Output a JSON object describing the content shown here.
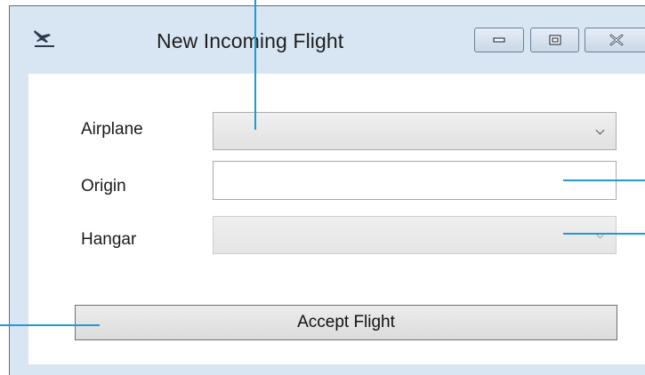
{
  "window": {
    "title": "New Incoming Flight",
    "icon": "airplane-icon",
    "controls": {
      "minimize": "minimize-icon",
      "maximize": "maximize-icon",
      "close": "close-icon"
    }
  },
  "form": {
    "airplane": {
      "label": "Airplane",
      "value": ""
    },
    "origin": {
      "label": "Origin",
      "value": ""
    },
    "hangar": {
      "label": "Hangar",
      "value": ""
    },
    "accept_label": "Accept Flight"
  },
  "colors": {
    "window_frame": "#d8e6f3",
    "callout": "#1e9ad6"
  }
}
